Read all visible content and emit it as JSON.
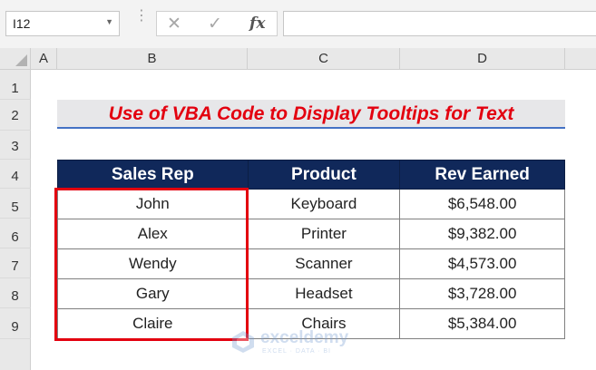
{
  "formula_bar": {
    "name_box_value": "I12",
    "cancel_glyph": "✕",
    "enter_glyph": "✓",
    "fx_label": "fx",
    "formula_value": ""
  },
  "columns": [
    "A",
    "B",
    "C",
    "D"
  ],
  "rows": [
    "1",
    "2",
    "3",
    "4",
    "5",
    "6",
    "7",
    "8",
    "9"
  ],
  "title": "Use of VBA Code to Display Tooltips for Text",
  "table": {
    "headers": [
      "Sales Rep",
      "Product",
      "Rev Earned"
    ],
    "rows": [
      [
        "John",
        "Keyboard",
        "$6,548.00"
      ],
      [
        "Alex",
        "Printer",
        "$9,382.00"
      ],
      [
        "Wendy",
        "Scanner",
        "$4,573.00"
      ],
      [
        "Gary",
        "Headset",
        "$3,728.00"
      ],
      [
        "Claire",
        "Chairs",
        "$5,384.00"
      ]
    ]
  },
  "watermark": {
    "name": "exceldemy",
    "tagline": "EXCEL · DATA · BI"
  },
  "colors": {
    "title_text": "#e3000f",
    "header_fill": "#10285a",
    "highlight_border": "#e3000f",
    "title_underline": "#4472c4"
  }
}
